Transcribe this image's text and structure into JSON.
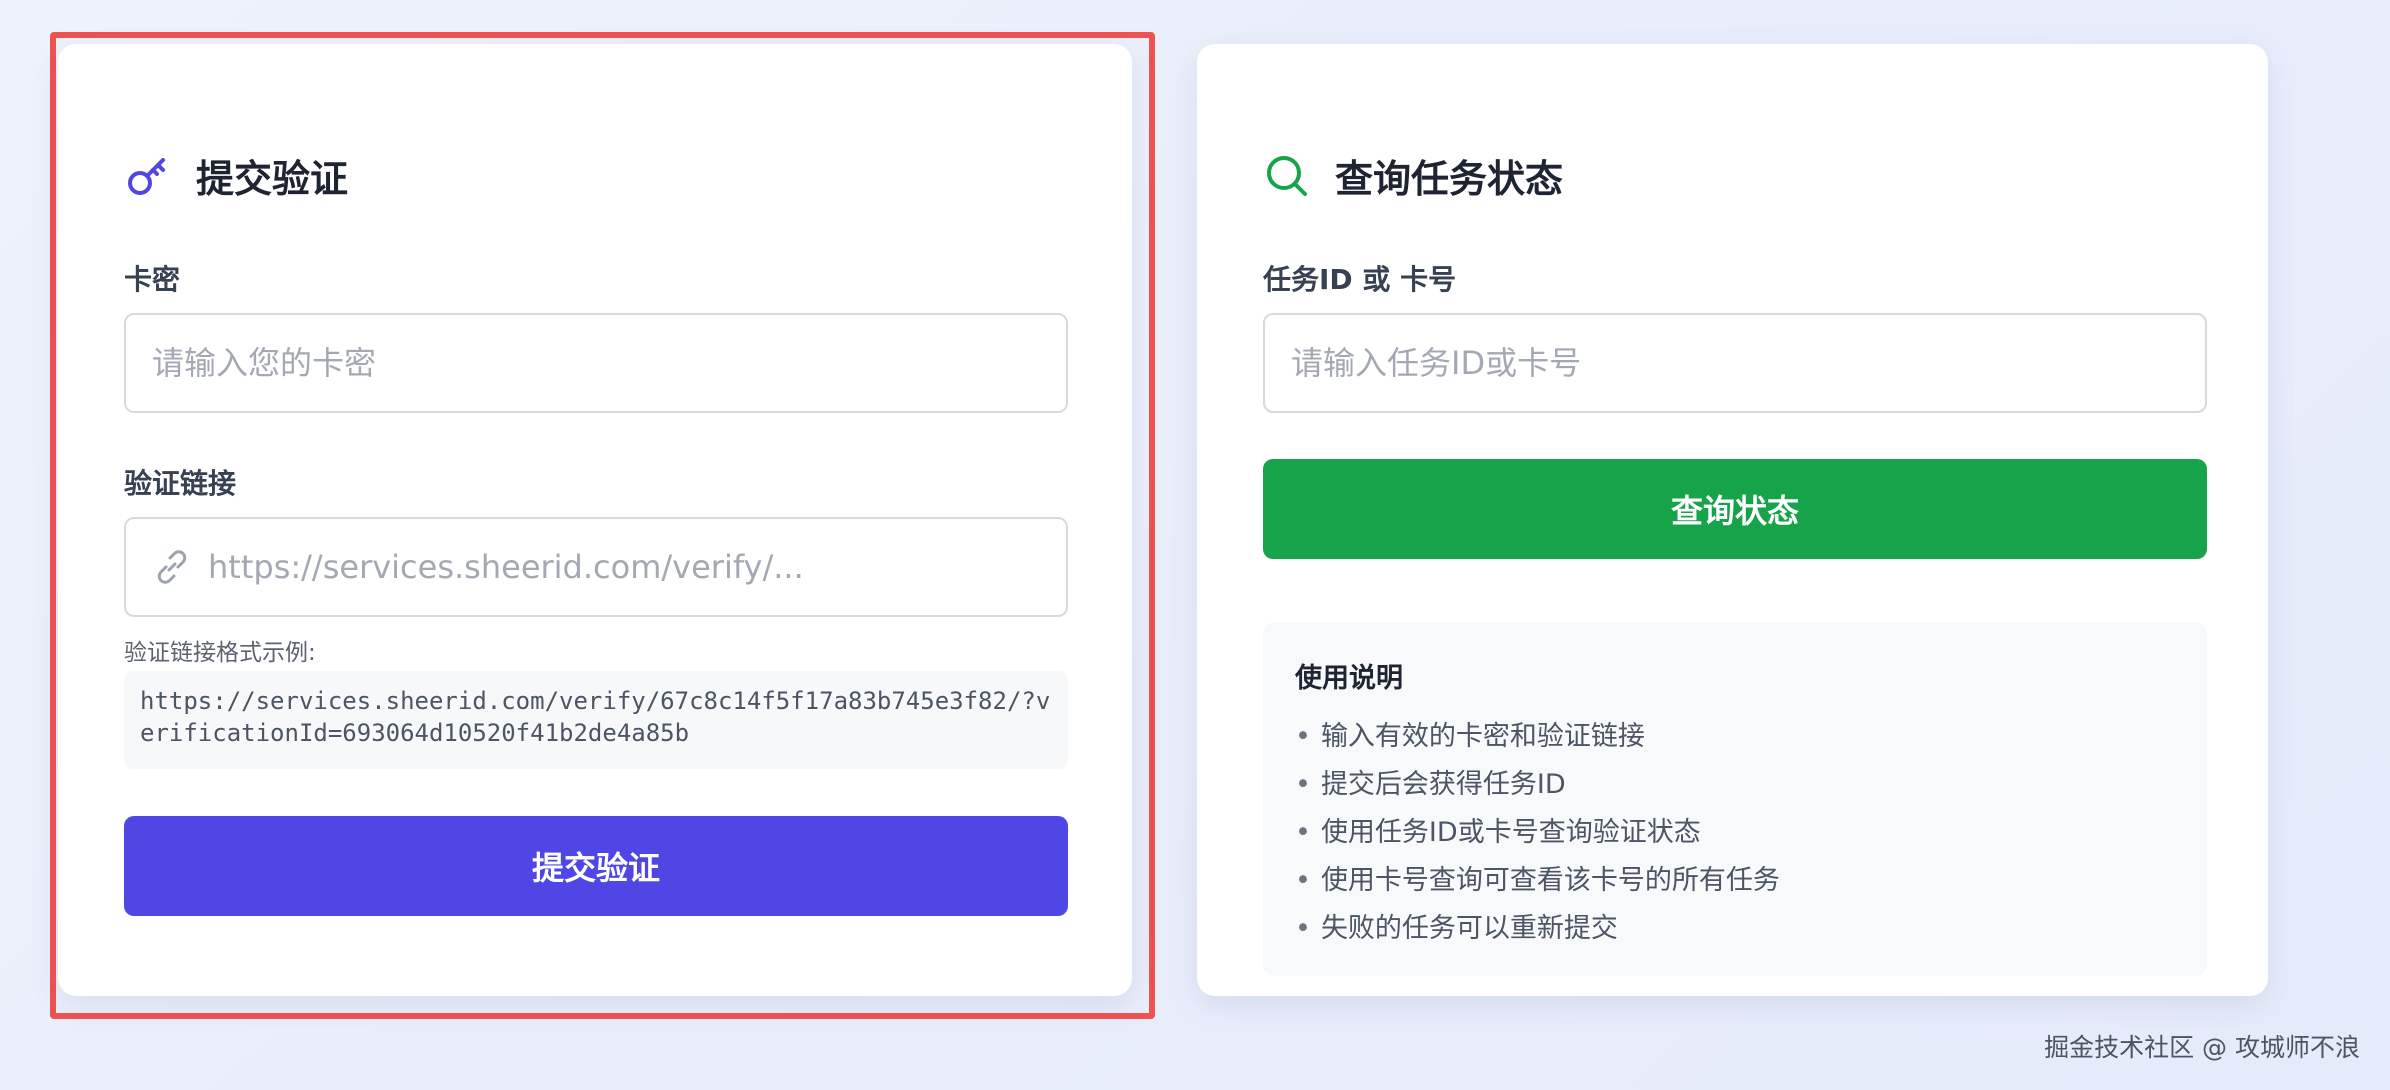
{
  "submit_panel": {
    "title": "提交验证",
    "title_icon": "key-icon",
    "card_key_label": "卡密",
    "card_key_placeholder": "请输入您的卡密",
    "card_key_value": "",
    "link_label": "验证链接",
    "link_icon": "link-icon",
    "link_placeholder": "https://services.sheerid.com/verify/...",
    "link_value": "",
    "format_hint": "验证链接格式示例:",
    "format_example": "https://services.sheerid.com/verify/67c8c14f5f17a83b745e3f82/?verificationId=693064d10520f41b2de4a85b",
    "submit_label": "提交验证",
    "accent_color": "#4f46e5"
  },
  "query_panel": {
    "title": "查询任务状态",
    "title_icon": "search-icon",
    "field_label": "任务ID 或 卡号",
    "field_placeholder": "请输入任务ID或卡号",
    "field_value": "",
    "query_label": "查询状态",
    "accent_color": "#16a34a",
    "instructions": {
      "title": "使用说明",
      "items": [
        "输入有效的卡密和验证链接",
        "提交后会获得任务ID",
        "使用任务ID或卡号查询验证状态",
        "使用卡号查询可查看该卡号的所有任务",
        "失败的任务可以重新提交"
      ]
    }
  },
  "watermark": "掘金技术社区 @ 攻城师不浪",
  "highlight_color": "#ef5350"
}
